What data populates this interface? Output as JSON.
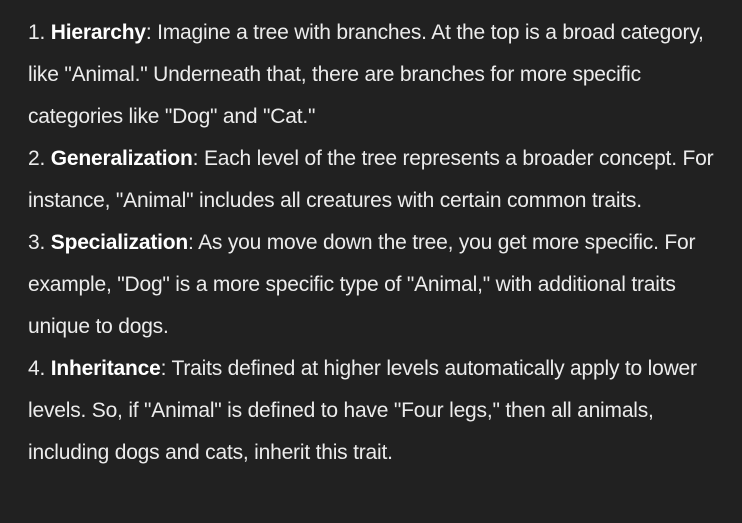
{
  "items": [
    {
      "number": "1.",
      "term": "Hierarchy",
      "text": ": Imagine a tree with branches. At the top is a broad category, like \"Animal.\" Underneath that, there are branches for more specific categories like \"Dog\" and \"Cat.\""
    },
    {
      "number": "2.",
      "term": "Generalization",
      "text": ": Each level of the tree represents a broader concept. For instance, \"Animal\" includes all creatures with certain common traits."
    },
    {
      "number": "3.",
      "term": "Specialization",
      "text": ": As you move down the tree, you get more specific. For example, \"Dog\" is a more specific type of \"Animal,\" with additional traits unique to dogs."
    },
    {
      "number": "4.",
      "term": "Inheritance",
      "text": ": Traits defined at higher levels automatically apply to lower levels. So, if \"Animal\" is defined to have \"Four legs,\" then all animals, including dogs and cats, inherit this trait."
    }
  ]
}
